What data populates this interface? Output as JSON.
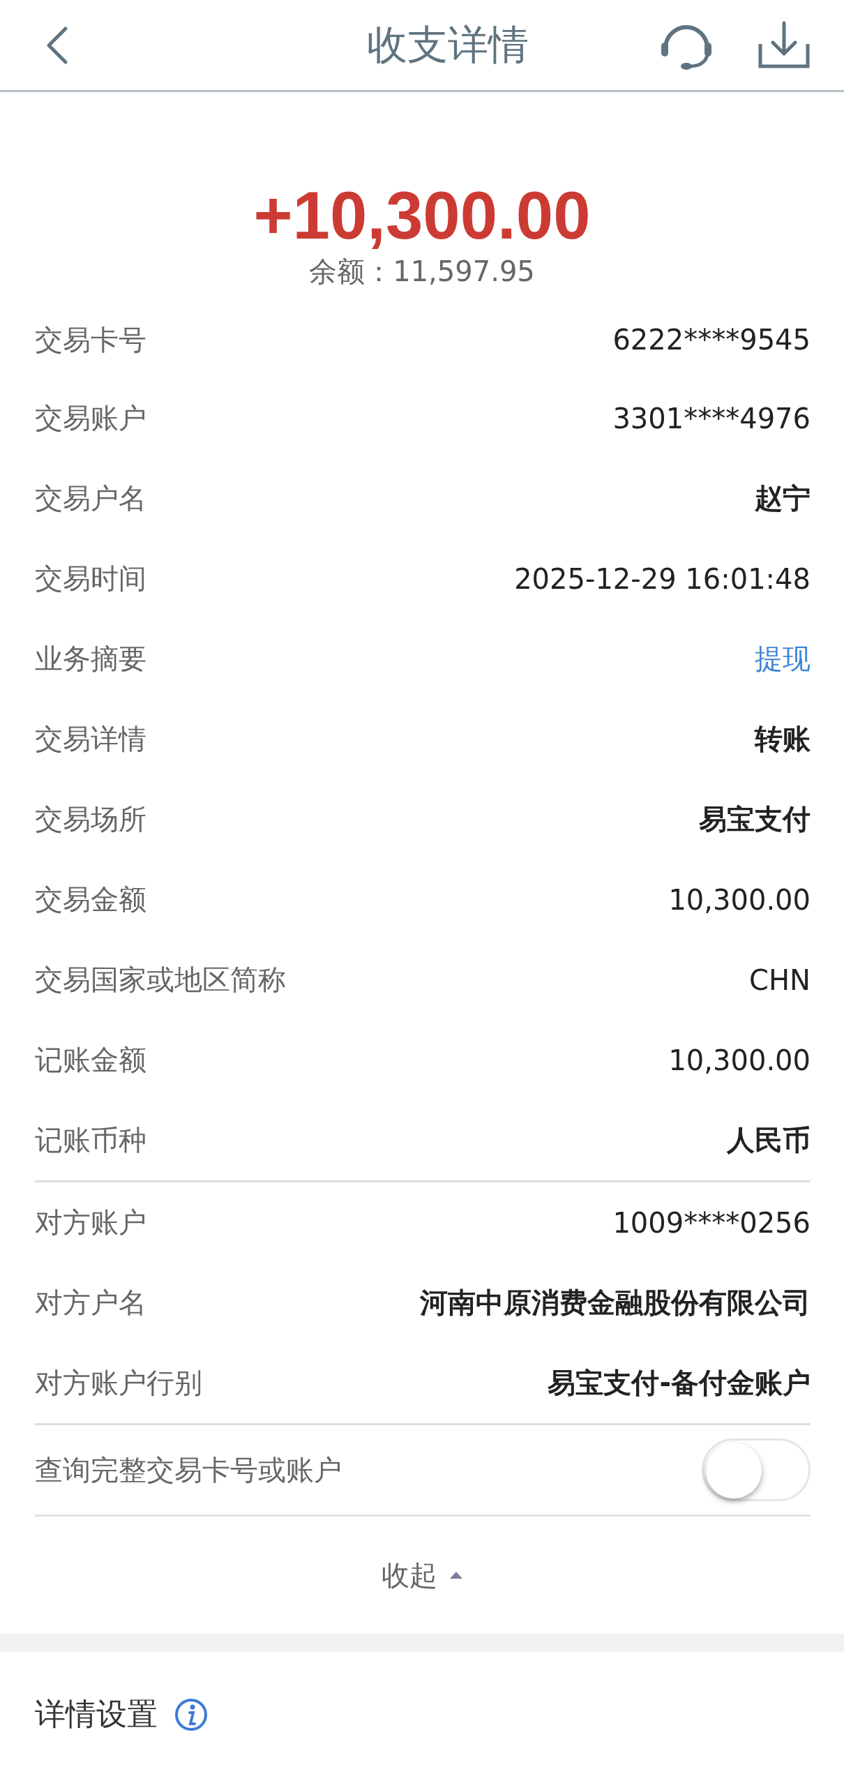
{
  "header": {
    "title": "收支详情"
  },
  "amount": "+10,300.00",
  "balance": {
    "label": "余额：",
    "value": "11,597.95"
  },
  "groups": [
    {
      "rows": [
        {
          "label": "交易卡号",
          "value": "6222****9545",
          "kind": "text"
        },
        {
          "label": "交易账户",
          "value": "3301****4976",
          "kind": "text"
        },
        {
          "label": "交易户名",
          "value": "赵宁",
          "kind": "bold"
        },
        {
          "label": "交易时间",
          "value": "2025-12-29 16:01:48",
          "kind": "text"
        },
        {
          "label": "业务摘要",
          "value": "提现",
          "kind": "link"
        },
        {
          "label": "交易详情",
          "value": "转账",
          "kind": "bold"
        },
        {
          "label": "交易场所",
          "value": "易宝支付",
          "kind": "bold"
        },
        {
          "label": "交易金额",
          "value": "10,300.00",
          "kind": "text"
        },
        {
          "label": "交易国家或地区简称",
          "value": "CHN",
          "kind": "text"
        },
        {
          "label": "记账金额",
          "value": "10,300.00",
          "kind": "text"
        },
        {
          "label": "记账币种",
          "value": "人民币",
          "kind": "bold"
        }
      ]
    },
    {
      "rows": [
        {
          "label": "对方账户",
          "value": "1009****0256",
          "kind": "text"
        },
        {
          "label": "对方户名",
          "value": "河南中原消费金融股份有限公司",
          "kind": "bold"
        },
        {
          "label": "对方账户行别",
          "value": "易宝支付-备付金账户",
          "kind": "bold"
        }
      ]
    }
  ],
  "full_number_toggle": {
    "label": "查询完整交易卡号或账户",
    "on": false
  },
  "collapse": {
    "label": "收起"
  },
  "settings": {
    "title": "详情设置"
  }
}
